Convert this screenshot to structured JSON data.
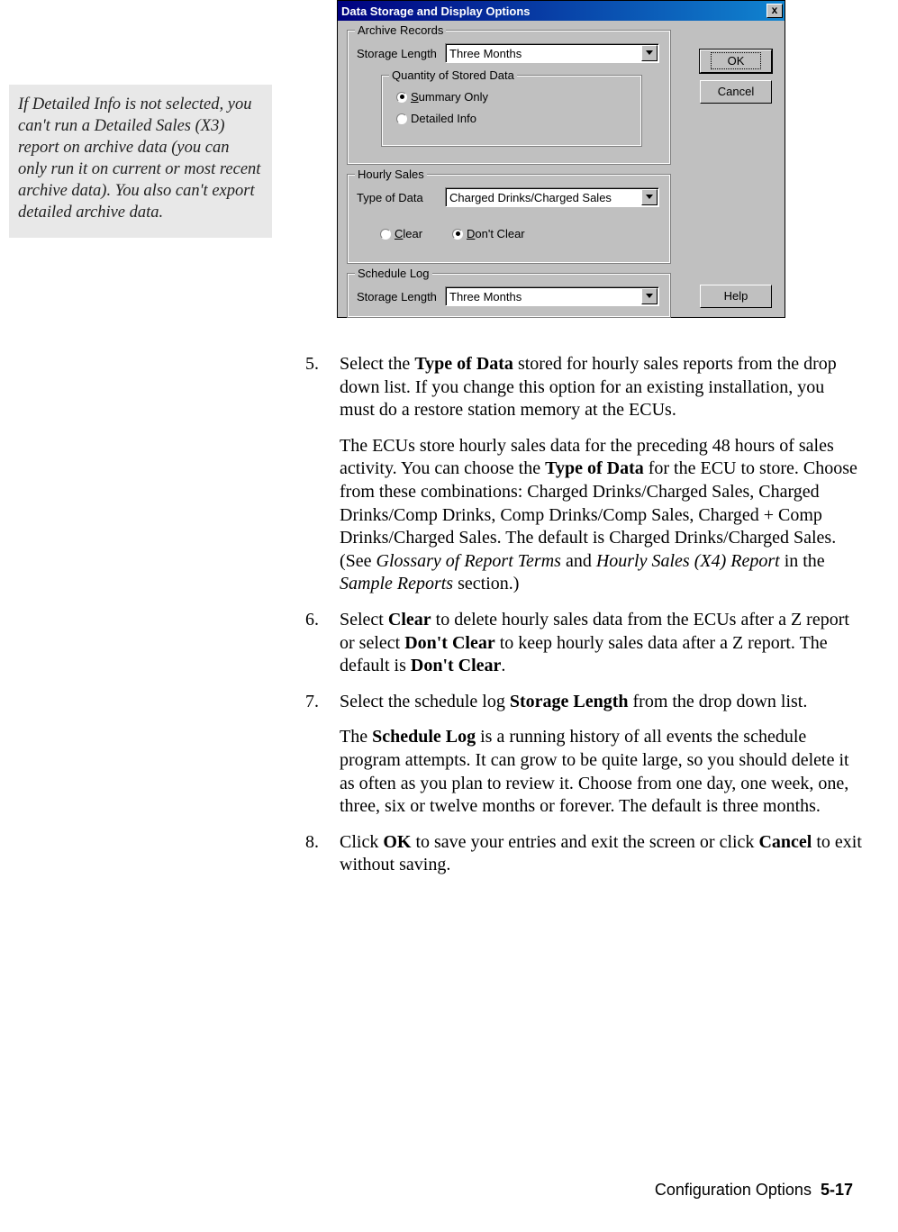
{
  "sidebar_note": "If Detailed Info is not selected, you can't run a Detailed Sales (X3) report on archive data (you can only run it on current or most recent archive data). You also can't export detailed archive data.",
  "dialog": {
    "title": "Data Storage and Display Options",
    "close_x": "x",
    "archive": {
      "legend": "Archive Records",
      "storage_length_label": "Storage Length",
      "storage_length_value": "Three Months",
      "qty_legend": "Quantity of Stored Data",
      "summary_only": "Summary Only",
      "detailed_info": "Detailed Info"
    },
    "hourly": {
      "legend": "Hourly Sales",
      "type_label": "Type of Data",
      "type_value": "Charged Drinks/Charged Sales",
      "clear": "Clear",
      "dont_clear": "Don't Clear"
    },
    "schedule": {
      "legend": "Schedule Log",
      "storage_length_label": "Storage Length",
      "storage_length_value": "Three Months"
    },
    "buttons": {
      "ok": "OK",
      "cancel": "Cancel",
      "help": "Help"
    }
  },
  "steps": {
    "s5_num": "5.",
    "s5_a": "Select the ",
    "s5_b": "Type of Data",
    "s5_c": " stored for hourly sales reports from the drop down list. If you change this option for an existing installation, you must do a restore station memory at the ECUs.",
    "s5p_a": "The ECUs store hourly sales data for the preceding 48 hours of sales activity. You can choose the ",
    "s5p_b": "Type of Data",
    "s5p_c": " for the ECU to store. Choose from these combinations: Charged Drinks/Charged Sales, Charged Drinks/Comp Drinks, Comp Drinks/Comp Sales, Charged + Comp Drinks/Charged Sales. The default is Charged Drinks/Charged Sales. (See ",
    "s5p_d": "Glossary of Report Terms",
    "s5p_e": " and ",
    "s5p_f": "Hourly Sales (X4) Report",
    "s5p_g": " in the ",
    "s5p_h": "Sample Reports",
    "s5p_i": " section.)",
    "s6_num": "6.",
    "s6_a": "Select ",
    "s6_b": "Clear",
    "s6_c": " to delete hourly sales data from the ECUs after a Z report or select ",
    "s6_d": "Don't Clear",
    "s6_e": " to keep hourly sales data after a Z report. The default is ",
    "s6_f": "Don't Clear",
    "s6_g": ".",
    "s7_num": "7.",
    "s7_a": "Select the schedule log ",
    "s7_b": "Storage Length",
    "s7_c": " from the drop down list.",
    "s7p_a": "The ",
    "s7p_b": "Schedule Log",
    "s7p_c": " is a running history of all events the schedule program attempts. It can grow to be quite large, so you should delete it as often as you plan to review it. Choose from one day, one week, one, three, six or twelve months or forever. The default is three months.",
    "s8_num": "8.",
    "s8_a": "Click ",
    "s8_b": "OK",
    "s8_c": " to save your entries and exit the screen or click ",
    "s8_d": "Cancel",
    "s8_e": " to exit without saving."
  },
  "footer": {
    "section": "Configuration Options",
    "page": "5-17"
  }
}
